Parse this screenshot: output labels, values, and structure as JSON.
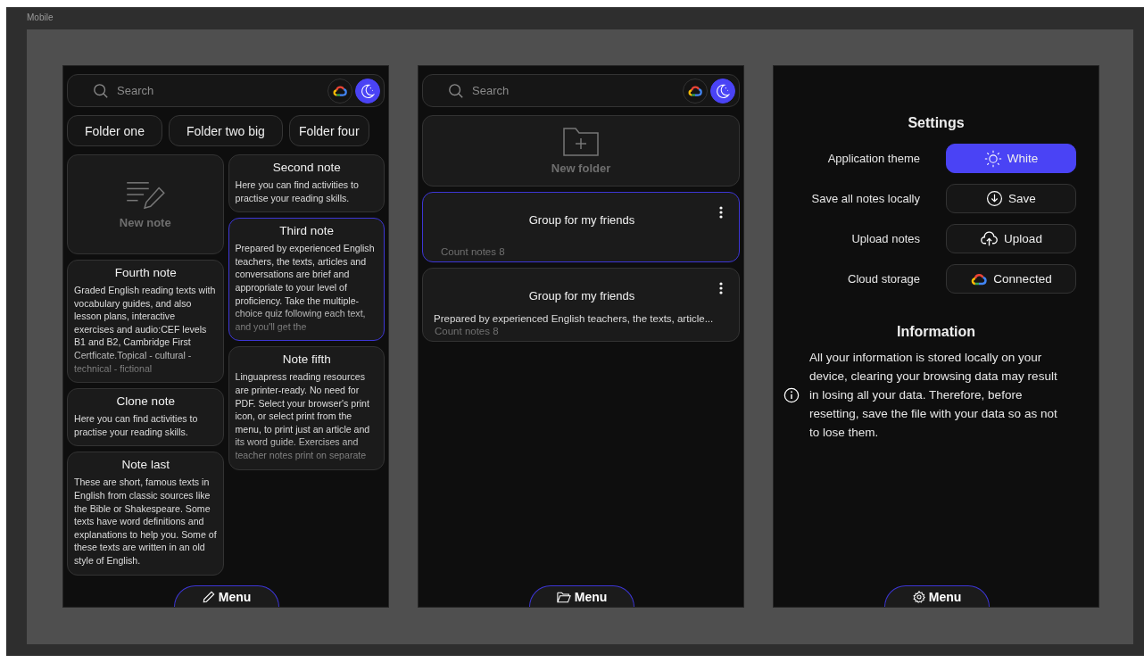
{
  "frame_label": "Mobile",
  "screens": [
    {
      "kind": "notes",
      "search": {
        "placeholder": "Search"
      },
      "folders": [
        {
          "label": "Folder one"
        },
        {
          "label": "Folder two big"
        },
        {
          "label": "Folder four"
        }
      ],
      "columns": [
        [
          {
            "kind": "new",
            "title": "New note"
          },
          {
            "kind": "note",
            "title": "Fourth note",
            "text": "Graded English reading texts with vocabulary guides, and also lesson plans, interactive exercises and audio:CEF levels B1 and B2, Cambridge First Certficate.Topical - cultural - technical - fictional",
            "selected": false,
            "faded": true
          },
          {
            "kind": "note",
            "title": "Clone note",
            "text": "Here you can find activities to practise your reading skills.",
            "selected": false,
            "faded": false
          },
          {
            "kind": "note",
            "title": "Note last",
            "text": "These are short, famous texts in English from classic sources like the Bible or Shakespeare. Some texts have word definitions and explanations to help you. Some of these texts are written in an old style of English.",
            "selected": false,
            "faded": false
          }
        ],
        [
          {
            "kind": "note",
            "title": "Second note",
            "text": "Here you can find activities to practise your reading skills.",
            "selected": false,
            "faded": false
          },
          {
            "kind": "note",
            "title": "Third note",
            "text": "Prepared by experienced English teachers, the texts, articles and conversations are brief and appropriate to your level of proficiency. Take the multiple-choice quiz following each text, and you'll get the",
            "selected": true,
            "faded": true
          },
          {
            "kind": "note",
            "title": "Note fifth",
            "text": "Linguapress reading resources are printer-ready. No need for PDF. Select your browser's print icon, or select print from the menu, to print just an article and its word guide. Exercises and teacher notes print on separate",
            "selected": false,
            "faded": true
          }
        ]
      ],
      "menu": "Menu"
    },
    {
      "kind": "folders",
      "search": {
        "placeholder": "Search"
      },
      "new_folder": "New folder",
      "groups": [
        {
          "title": "Group for my friends",
          "count": "Count notes 8",
          "selected": true
        },
        {
          "title": "Group for my friends",
          "description": "Prepared by experienced English teachers, the texts, article...",
          "count": "Count notes 8",
          "selected": false
        }
      ],
      "menu": "Menu"
    },
    {
      "kind": "settings",
      "title": "Settings",
      "rows": [
        {
          "kind": "theme",
          "label": "Application theme",
          "button": "White",
          "selected": true
        },
        {
          "kind": "save",
          "label": "Save all notes locally",
          "button": "Save",
          "selected": false
        },
        {
          "kind": "upload",
          "label": "Upload notes",
          "button": "Upload",
          "selected": false
        },
        {
          "kind": "cloud",
          "label": "Cloud storage",
          "button": "Connected",
          "selected": false
        }
      ],
      "info_title": "Information",
      "info_text": "All your information is stored locally on your device, clearing your browsing data may result in losing all your data. Therefore, before resetting, save the file with your data so as not to lose them.",
      "menu": "Menu"
    }
  ]
}
